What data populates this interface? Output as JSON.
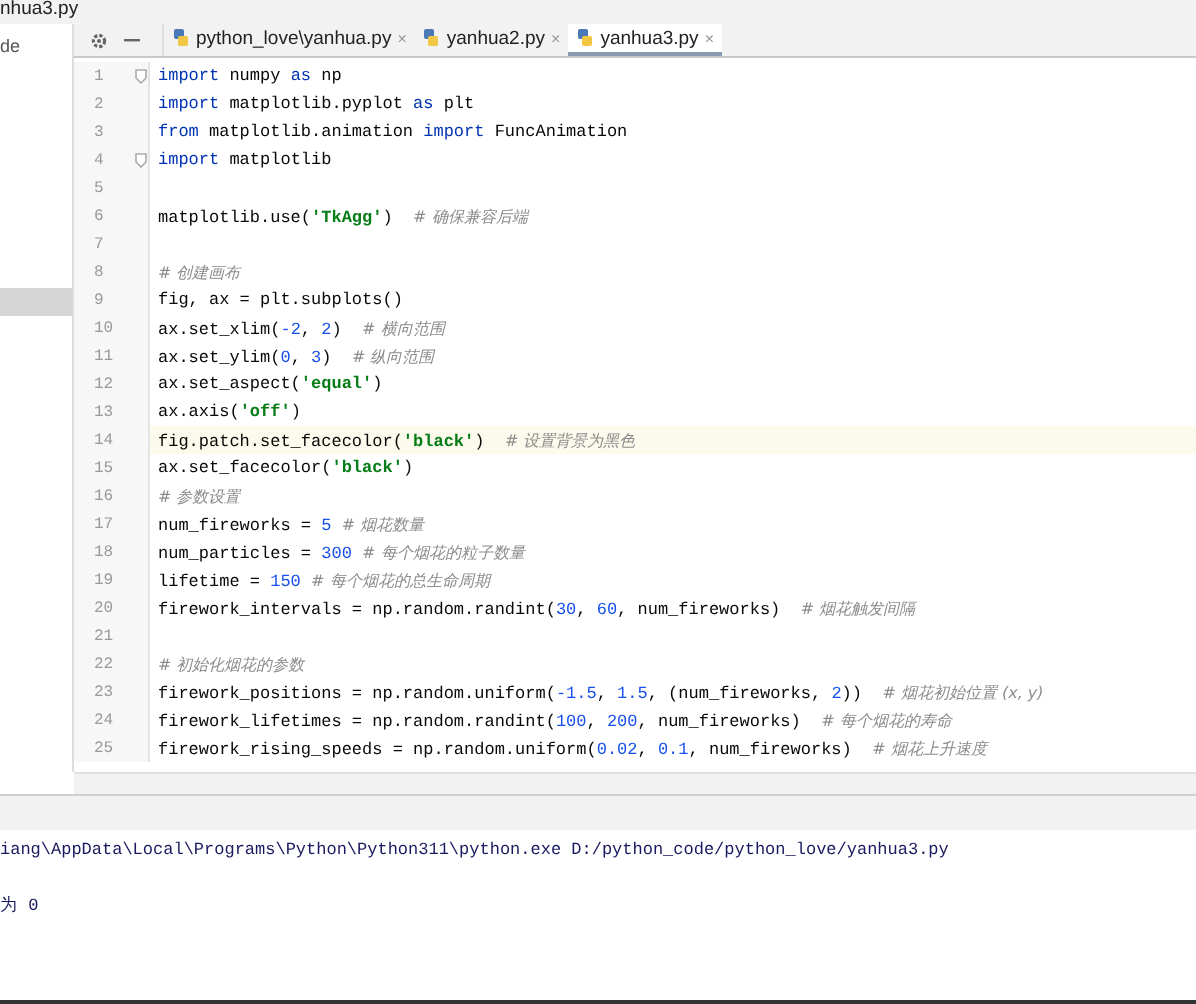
{
  "window": {
    "title": "nhua3.py"
  },
  "project_panel": {
    "label": "de",
    "selected_row": true
  },
  "tabs": [
    {
      "label": "python_love\\yanhua.py",
      "close": "×",
      "selected": false
    },
    {
      "label": "yanhua2.py",
      "close": "×",
      "selected": false
    },
    {
      "label": "yanhua3.py",
      "close": "×",
      "selected": true
    }
  ],
  "editor": {
    "lines": [
      {
        "number": "1",
        "fold": true,
        "current": false,
        "tokens": [
          {
            "kind": "keyword",
            "text": "import"
          },
          {
            "kind": "plain",
            "text": " numpy "
          },
          {
            "kind": "keyword",
            "text": "as"
          },
          {
            "kind": "plain",
            "text": " np"
          }
        ]
      },
      {
        "number": "2",
        "fold": false,
        "current": false,
        "tokens": [
          {
            "kind": "keyword",
            "text": "import"
          },
          {
            "kind": "plain",
            "text": " matplotlib.pyplot "
          },
          {
            "kind": "keyword",
            "text": "as"
          },
          {
            "kind": "plain",
            "text": " plt"
          }
        ]
      },
      {
        "number": "3",
        "fold": false,
        "current": false,
        "tokens": [
          {
            "kind": "keyword",
            "text": "from"
          },
          {
            "kind": "plain",
            "text": " matplotlib.animation "
          },
          {
            "kind": "keyword",
            "text": "import"
          },
          {
            "kind": "plain",
            "text": " FuncAnimation"
          }
        ]
      },
      {
        "number": "4",
        "fold": true,
        "current": false,
        "tokens": [
          {
            "kind": "keyword",
            "text": "import"
          },
          {
            "kind": "plain",
            "text": " matplotlib"
          }
        ]
      },
      {
        "number": "5",
        "fold": false,
        "current": false
      },
      {
        "number": "6",
        "fold": false,
        "current": false,
        "tokens": [
          {
            "kind": "plain",
            "text": "matplotlib.use("
          },
          {
            "kind": "string",
            "text": "'TkAgg'"
          },
          {
            "kind": "plain",
            "text": ")  "
          },
          {
            "kind": "comment",
            "text": "# 确保兼容后端"
          }
        ]
      },
      {
        "number": "7",
        "fold": false,
        "current": false
      },
      {
        "number": "8",
        "fold": false,
        "current": false,
        "tokens": [
          {
            "kind": "comment",
            "text": "# 创建画布"
          }
        ]
      },
      {
        "number": "9",
        "fold": false,
        "current": false,
        "tokens": [
          {
            "kind": "plain",
            "text": "fig, ax = plt.subplots()"
          }
        ]
      },
      {
        "number": "10",
        "fold": false,
        "current": false,
        "tokens": [
          {
            "kind": "plain",
            "text": "ax.set_xlim("
          },
          {
            "kind": "number",
            "text": "-2"
          },
          {
            "kind": "plain",
            "text": ", "
          },
          {
            "kind": "number",
            "text": "2"
          },
          {
            "kind": "plain",
            "text": ")  "
          },
          {
            "kind": "comment",
            "text": "# 横向范围"
          }
        ]
      },
      {
        "number": "11",
        "fold": false,
        "current": false,
        "tokens": [
          {
            "kind": "plain",
            "text": "ax.set_ylim("
          },
          {
            "kind": "number",
            "text": "0"
          },
          {
            "kind": "plain",
            "text": ", "
          },
          {
            "kind": "number",
            "text": "3"
          },
          {
            "kind": "plain",
            "text": ")  "
          },
          {
            "kind": "comment",
            "text": "# 纵向范围"
          }
        ]
      },
      {
        "number": "12",
        "fold": false,
        "current": false,
        "tokens": [
          {
            "kind": "plain",
            "text": "ax.set_aspect("
          },
          {
            "kind": "string",
            "text": "'equal'"
          },
          {
            "kind": "plain",
            "text": ")"
          }
        ]
      },
      {
        "number": "13",
        "fold": false,
        "current": false,
        "tokens": [
          {
            "kind": "plain",
            "text": "ax.axis("
          },
          {
            "kind": "string",
            "text": "'off'"
          },
          {
            "kind": "plain",
            "text": ")"
          }
        ]
      },
      {
        "number": "14",
        "fold": false,
        "current": true,
        "tokens": [
          {
            "kind": "plain",
            "text": "fig.patch.set_facecolor("
          },
          {
            "kind": "string",
            "text": "'black'"
          },
          {
            "kind": "plain",
            "text": ")  "
          },
          {
            "kind": "comment",
            "text": "# 设置背景为黑色"
          }
        ]
      },
      {
        "number": "15",
        "fold": false,
        "current": false,
        "tokens": [
          {
            "kind": "plain",
            "text": "ax.set_facecolor("
          },
          {
            "kind": "string",
            "text": "'black'"
          },
          {
            "kind": "plain",
            "text": ")"
          }
        ]
      },
      {
        "number": "16",
        "fold": false,
        "current": false,
        "tokens": [
          {
            "kind": "comment",
            "text": "# 参数设置"
          }
        ]
      },
      {
        "number": "17",
        "fold": false,
        "current": false,
        "tokens": [
          {
            "kind": "plain",
            "text": "num_fireworks = "
          },
          {
            "kind": "number",
            "text": "5"
          },
          {
            "kind": "comment",
            "text": "  # 烟花数量"
          }
        ]
      },
      {
        "number": "18",
        "fold": false,
        "current": false,
        "tokens": [
          {
            "kind": "plain",
            "text": "num_particles = "
          },
          {
            "kind": "number",
            "text": "300"
          },
          {
            "kind": "comment",
            "text": "  # 每个烟花的粒子数量"
          }
        ]
      },
      {
        "number": "19",
        "fold": false,
        "current": false,
        "tokens": [
          {
            "kind": "plain",
            "text": "lifetime = "
          },
          {
            "kind": "number",
            "text": "150"
          },
          {
            "kind": "comment",
            "text": "  # 每个烟花的总生命周期"
          }
        ]
      },
      {
        "number": "20",
        "fold": false,
        "current": false,
        "tokens": [
          {
            "kind": "plain",
            "text": "firework_intervals = np.random.randint("
          },
          {
            "kind": "number",
            "text": "30"
          },
          {
            "kind": "plain",
            "text": ", "
          },
          {
            "kind": "number",
            "text": "60"
          },
          {
            "kind": "plain",
            "text": ", num_fireworks)  "
          },
          {
            "kind": "comment",
            "text": "# 烟花触发间隔"
          }
        ]
      },
      {
        "number": "21",
        "fold": false,
        "current": false
      },
      {
        "number": "22",
        "fold": false,
        "current": false,
        "tokens": [
          {
            "kind": "comment",
            "text": "# 初始化烟花的参数"
          }
        ]
      },
      {
        "number": "23",
        "fold": false,
        "current": false,
        "tokens": [
          {
            "kind": "plain",
            "text": "firework_positions = np.random.uniform("
          },
          {
            "kind": "number",
            "text": "-1.5"
          },
          {
            "kind": "plain",
            "text": ", "
          },
          {
            "kind": "number",
            "text": "1.5"
          },
          {
            "kind": "plain",
            "text": ", (num_fireworks, "
          },
          {
            "kind": "number",
            "text": "2"
          },
          {
            "kind": "plain",
            "text": "))  "
          },
          {
            "kind": "comment",
            "text": "# 烟花初始位置 (x, y)"
          }
        ]
      },
      {
        "number": "24",
        "fold": false,
        "current": false,
        "tokens": [
          {
            "kind": "plain",
            "text": "firework_lifetimes = np.random.randint("
          },
          {
            "kind": "number",
            "text": "100"
          },
          {
            "kind": "plain",
            "text": ", "
          },
          {
            "kind": "number",
            "text": "200"
          },
          {
            "kind": "plain",
            "text": ", num_fireworks)  "
          },
          {
            "kind": "comment",
            "text": "# 每个烟花的寿命"
          }
        ]
      },
      {
        "number": "25",
        "fold": false,
        "current": false,
        "tokens": [
          {
            "kind": "plain",
            "text": "firework_rising_speeds = np.random.uniform("
          },
          {
            "kind": "number",
            "text": "0.02"
          },
          {
            "kind": "plain",
            "text": ", "
          },
          {
            "kind": "number",
            "text": "0.1"
          },
          {
            "kind": "plain",
            "text": ", num_fireworks)  "
          },
          {
            "kind": "comment",
            "text": "# 烟花上升速度"
          }
        ]
      }
    ]
  },
  "console": {
    "lines": [
      {
        "text": "iang\\AppData\\Local\\Programs\\Python\\Python311\\python.exe D:/python_code/python_love/yanhua3.py"
      },
      {
        "text": "为 0",
        "gap_before": true
      }
    ]
  }
}
